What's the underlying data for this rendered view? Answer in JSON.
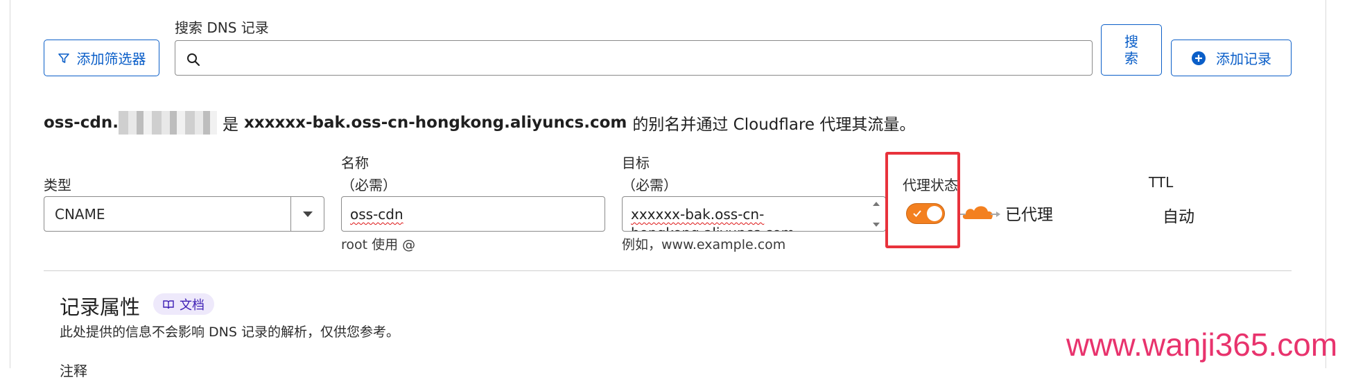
{
  "toolbar": {
    "filter_label": "添加筛选器",
    "search_label": "搜索 DNS 记录",
    "search_value": "",
    "search_button": "搜\n索",
    "add_record_label": "添加记录"
  },
  "summary": {
    "name_prefix": "oss-cdn.",
    "connector": "是",
    "target": "xxxxxx-bak.oss-cn-hongkong.aliyuncs.com",
    "suffix": "的别名并通过 Cloudflare 代理其流量。"
  },
  "form": {
    "type_label": "类型",
    "type_value": "CNAME",
    "name_label": "名称",
    "name_required": "（必需）",
    "name_value": "oss-cdn",
    "name_hint": "root 使用 @",
    "target_label": "目标",
    "target_required": "（必需）",
    "target_value_line1": "xxxxxx-bak.oss-cn-",
    "target_value_line2": "hongkong.aliyuncs.com",
    "target_hint": "例如，www.example.com",
    "proxy_label": "代理状态",
    "proxy_on": true,
    "proxy_status": "已代理",
    "ttl_label": "TTL",
    "ttl_value": "自动"
  },
  "record_attributes": {
    "title": "记录属性",
    "docs_label": "文档",
    "description": "此处提供的信息不会影响 DNS 记录的解析，仅供您参考。",
    "comment_label": "注释"
  },
  "watermark": "www.wanji365.com",
  "colors": {
    "accent": "#0a5ec8",
    "toggle": "#f38020",
    "highlight": "#e8323c",
    "watermark": "#e8336d"
  }
}
